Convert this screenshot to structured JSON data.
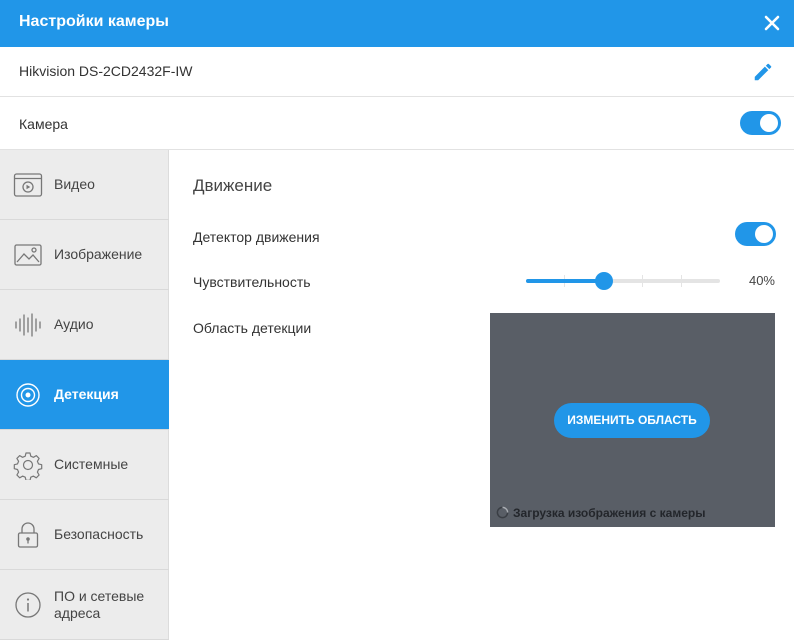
{
  "header": {
    "title": "Настройки камеры",
    "close_icon": "close-icon"
  },
  "camera": {
    "model": "Hikvision DS-2CD2432F-IW",
    "edit_icon": "pencil-icon",
    "enabled_label": "Камера",
    "enabled": true
  },
  "sidebar": {
    "items": [
      {
        "label": "Видео",
        "icon": "video-icon",
        "active": false
      },
      {
        "label": "Изображение",
        "icon": "image-icon",
        "active": false
      },
      {
        "label": "Аудио",
        "icon": "audio-icon",
        "active": false
      },
      {
        "label": "Детекция",
        "icon": "detection-icon",
        "active": true
      },
      {
        "label": "Системные",
        "icon": "gear-icon",
        "active": false
      },
      {
        "label": "Безопасность",
        "icon": "lock-icon",
        "active": false
      },
      {
        "label": "ПО и сетевые адреса",
        "icon": "info-icon",
        "active": false
      }
    ]
  },
  "main": {
    "section_title": "Движение",
    "motion_detector_label": "Детектор движения",
    "motion_detector_enabled": true,
    "sensitivity_label": "Чувствительность",
    "sensitivity_value": "40%",
    "sensitivity_fraction": 0.4,
    "detection_area_label": "Область детекции",
    "change_area_button": "ИЗМЕНИТЬ ОБЛАСТЬ",
    "loading_text": "Загрузка изображения с камеры"
  },
  "colors": {
    "accent": "#2196e8",
    "sidebar_bg": "#ececec",
    "preview_bg": "#595e66"
  }
}
